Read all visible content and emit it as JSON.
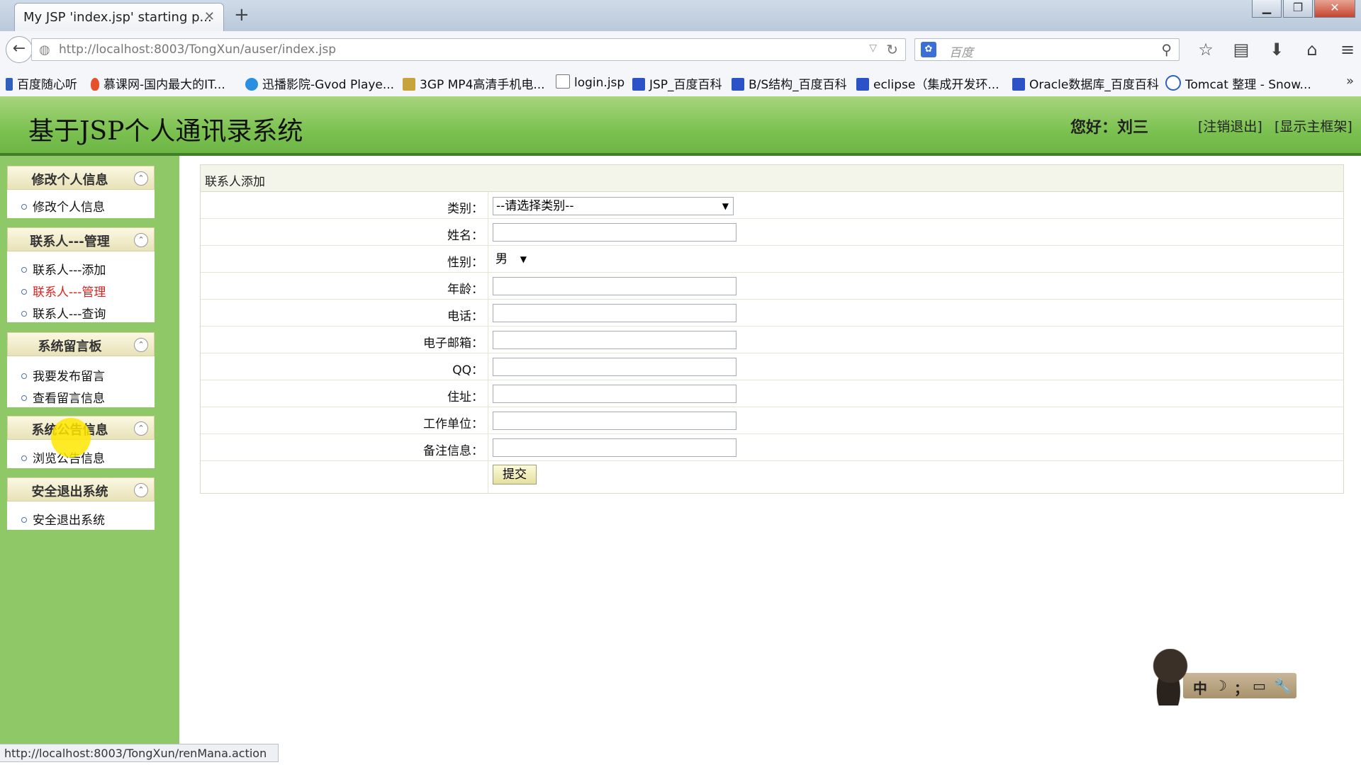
{
  "browser": {
    "tab_title": "My JSP 'index.jsp' starting p...",
    "tab_close": "✕",
    "new_tab": "+",
    "window_controls": [
      "▁",
      "❐",
      "✕"
    ],
    "url": "http://localhost:8003/TongXun/auser/index.jsp",
    "search_placeholder": "百度",
    "bookmarks": [
      {
        "label": "百度随心听",
        "icon": "music-note-icon"
      },
      {
        "label": "慕课网-国内最大的IT...",
        "icon": "flame-icon"
      },
      {
        "label": "迅播影院-Gvod Playe...",
        "icon": "play-circle-icon"
      },
      {
        "label": "3GP MP4高清手机电...",
        "icon": "pen-icon"
      },
      {
        "label": "login.jsp",
        "icon": "page-icon"
      },
      {
        "label": "JSP_百度百科",
        "icon": "baidu-paw-icon"
      },
      {
        "label": "B/S结构_百度百科",
        "icon": "baidu-paw-icon"
      },
      {
        "label": "eclipse（集成开发环...",
        "icon": "baidu-paw-icon"
      },
      {
        "label": "Oracle数据库_百度百科",
        "icon": "baidu-paw-icon"
      },
      {
        "label": "Tomcat 整理 - Snow...",
        "icon": "g-logo-icon"
      }
    ],
    "bookmarks_more": "»",
    "status_url": "http://localhost:8003/TongXun/renMana.action"
  },
  "header": {
    "title": "基于JSP个人通讯录系统",
    "greeting": "您好：刘三",
    "logout_link": "[注销退出]",
    "frame_link": "[显示主框架]"
  },
  "sidebar": {
    "groups": [
      {
        "title": "修改个人信息",
        "items": [
          "修改个人信息"
        ]
      },
      {
        "title": "联系人---管理",
        "items": [
          "联系人---添加",
          "联系人---管理",
          "联系人---查询"
        ]
      },
      {
        "title": "系统留言板",
        "items": [
          "我要发布留言",
          "查看留言信息"
        ]
      },
      {
        "title": "系统公告信息",
        "items": [
          "浏览公告信息"
        ]
      },
      {
        "title": "安全退出系统",
        "items": [
          "安全退出系统"
        ]
      }
    ],
    "active_item": "联系人---管理"
  },
  "form": {
    "caption": "联系人添加",
    "category_label": "类别：",
    "category_value": "--请选择类别--",
    "name_label": "姓名：",
    "gender_label": "性别：",
    "gender_value": "男",
    "age_label": "年龄：",
    "phone_label": "电话：",
    "email_label": "电子邮箱：",
    "qq_label": "QQ：",
    "address_label": "住址：",
    "company_label": "工作单位：",
    "remark_label": "备注信息：",
    "submit_label": "提交"
  },
  "ime": {
    "glyphs": [
      "中",
      "☽",
      "；",
      "▭",
      "🔧"
    ]
  },
  "colors": {
    "header_green": "#7cc251",
    "sidebar_green": "#8fc866",
    "active_red": "#e0201c"
  }
}
